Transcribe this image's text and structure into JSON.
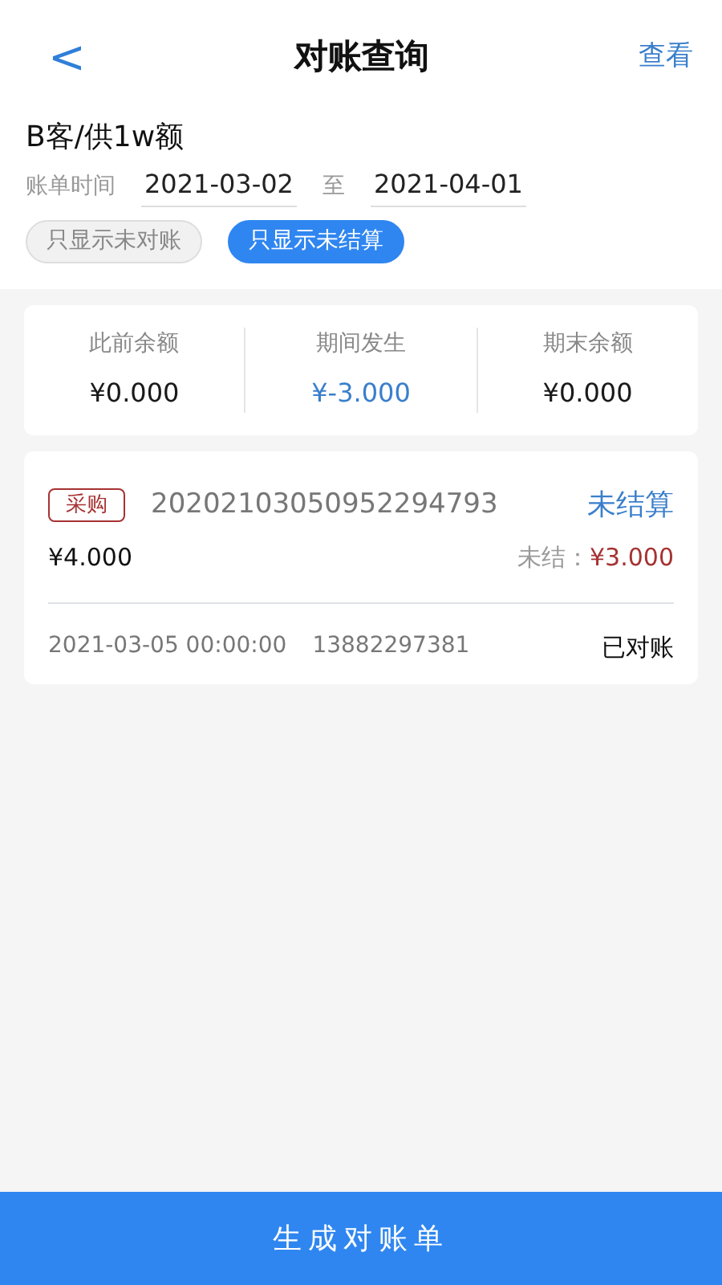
{
  "header": {
    "back": "<",
    "title": "对账查询",
    "action": "查看"
  },
  "filter": {
    "party": "B客/供1w额",
    "date_label": "账单时间",
    "date_from": "2021-03-02",
    "date_sep": "至",
    "date_to": "2021-04-01",
    "chips": [
      {
        "label": "只显示未对账",
        "selected": false
      },
      {
        "label": "只显示未结算",
        "selected": true
      }
    ]
  },
  "summary": [
    {
      "label": "此前余额",
      "value": "¥0.000",
      "color": "#1a1a1a"
    },
    {
      "label": "期间发生",
      "value": "¥-3.000",
      "color": "#3a7fcc"
    },
    {
      "label": "期末余额",
      "value": "¥0.000",
      "color": "#1a1a1a"
    }
  ],
  "records": [
    {
      "tag": "采购",
      "order_no": "20202103050952294793",
      "status": "未结算",
      "amount": "¥4.000",
      "unsettled_label": "未结：",
      "unsettled_amount": "¥3.000",
      "datetime": "2021-03-05 00:00:00",
      "phone": "13882297381",
      "reconciled": "已对账"
    }
  ],
  "footer_button": "生成对账单"
}
